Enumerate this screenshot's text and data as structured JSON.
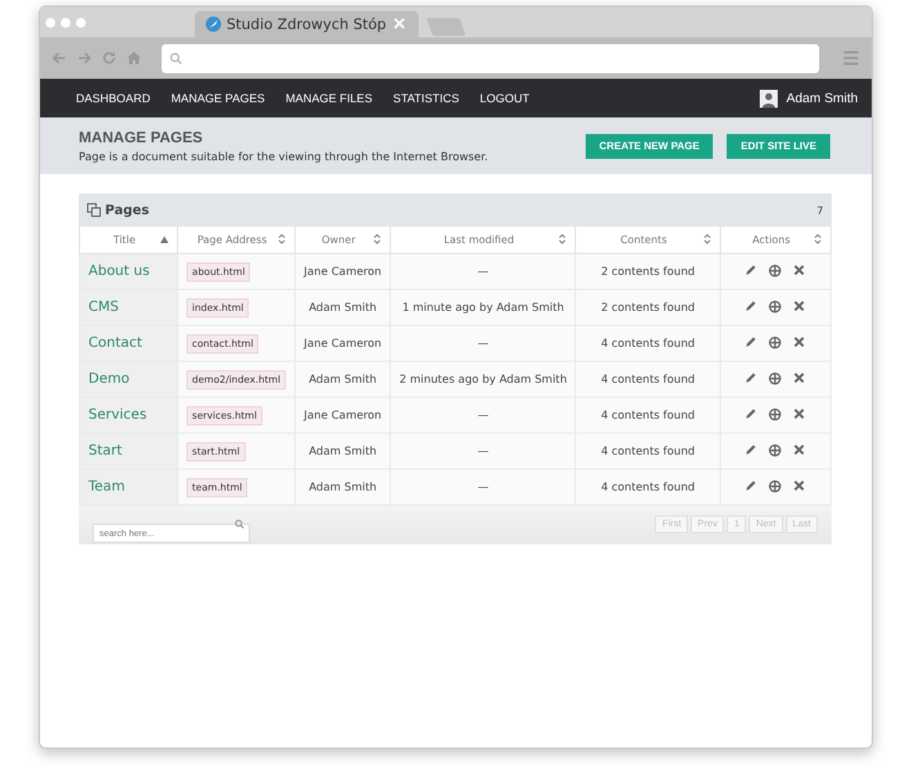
{
  "browser": {
    "tab_title": "Studio Zdrowych Stóp",
    "tab_close": "×"
  },
  "nav": {
    "items": [
      "DASHBOARD",
      "MANAGE PAGES",
      "MANAGE FILES",
      "STATISTICS",
      "LOGOUT"
    ],
    "user": "Adam Smith"
  },
  "header": {
    "title": "MANAGE PAGES",
    "description": "Page is a document suitable for the viewing through the Internet Browser.",
    "buttons": [
      "CREATE NEW PAGE",
      "EDIT SITE LIVE"
    ]
  },
  "panel": {
    "title": "Pages",
    "count": "7"
  },
  "table": {
    "columns": [
      {
        "label": "Title",
        "sorted": true
      },
      {
        "label": "Page Address",
        "sorted": false
      },
      {
        "label": "Owner",
        "sorted": false
      },
      {
        "label": "Last modified",
        "sorted": false
      },
      {
        "label": "Contents",
        "sorted": false
      },
      {
        "label": "Actions",
        "sorted": false
      }
    ],
    "rows": [
      {
        "title": "About us",
        "address": "about.html",
        "owner": "Jane Cameron",
        "modified": "—",
        "contents": "2 contents found"
      },
      {
        "title": "CMS",
        "address": "index.html",
        "owner": "Adam Smith",
        "modified": "1 minute ago by Adam Smith",
        "contents": "2 contents found"
      },
      {
        "title": "Contact",
        "address": "contact.html",
        "owner": "Jane Cameron",
        "modified": "—",
        "contents": "4 contents found"
      },
      {
        "title": "Demo",
        "address": "demo2/index.html",
        "owner": "Adam Smith",
        "modified": "2 minutes ago by Adam Smith",
        "contents": "4 contents found"
      },
      {
        "title": "Services",
        "address": "services.html",
        "owner": "Jane Cameron",
        "modified": "—",
        "contents": "4 contents found"
      },
      {
        "title": "Start",
        "address": "start.html",
        "owner": "Adam Smith",
        "modified": "—",
        "contents": "4 contents found"
      },
      {
        "title": "Team",
        "address": "team.html",
        "owner": "Adam Smith",
        "modified": "—",
        "contents": "4 contents found"
      }
    ]
  },
  "footer": {
    "search_placeholder": "search here...",
    "pager": [
      {
        "label": "First",
        "disabled": true
      },
      {
        "label": "Prev",
        "disabled": true
      },
      {
        "label": "1",
        "disabled": true
      },
      {
        "label": "Next",
        "disabled": true
      },
      {
        "label": "Last",
        "disabled": true
      }
    ]
  }
}
